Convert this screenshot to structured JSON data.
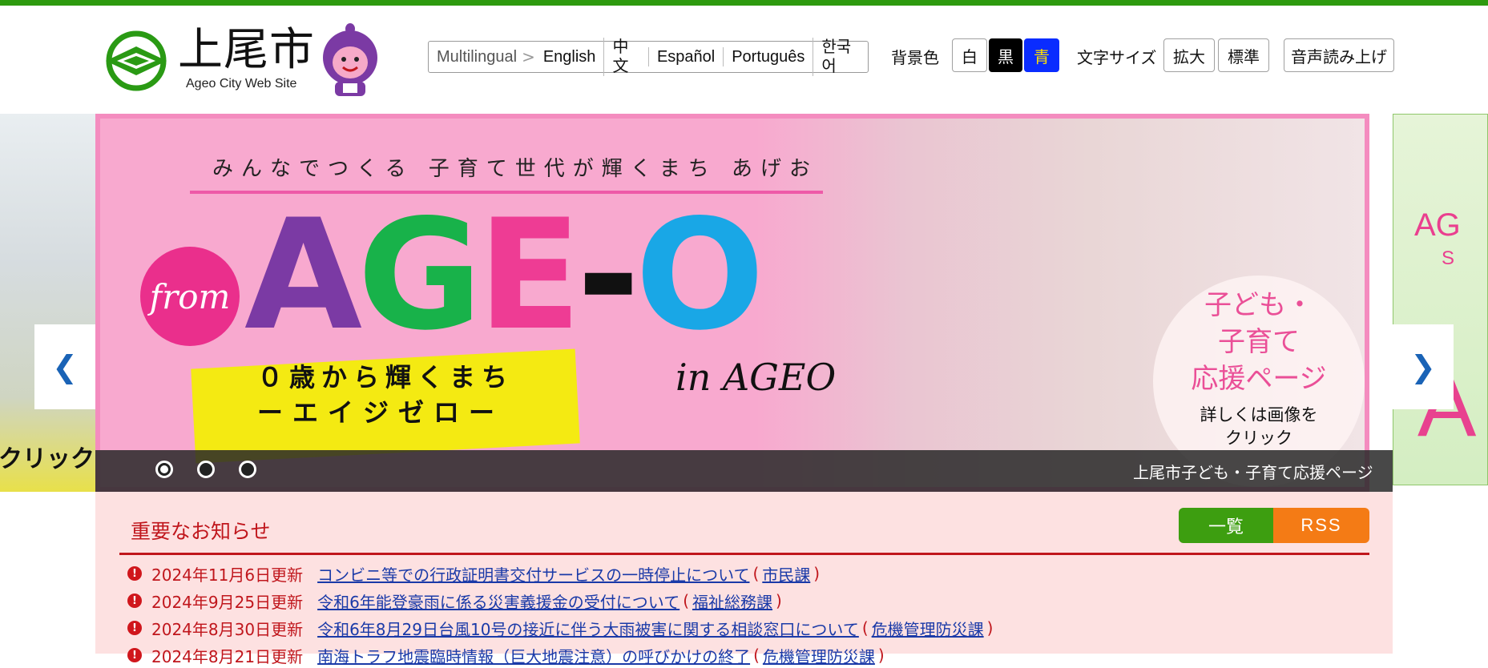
{
  "header": {
    "logo_title": "上尾市",
    "logo_sub": "Ageo City Web Site",
    "multilingual_label": "Multilingual",
    "languages": [
      "English",
      "中文",
      "Español",
      "Português",
      "한국어"
    ],
    "bg_color_label": "背景色",
    "bg_buttons": [
      "白",
      "黒",
      "青"
    ],
    "font_size_label": "文字サイズ",
    "font_buttons": [
      "拡大",
      "標準"
    ],
    "speech_button": "音声読み上げ"
  },
  "slider": {
    "left_side_text": "クリック",
    "right_side_text": "AG",
    "right_side_sub": "S",
    "right_side_big": "A",
    "tagline": "みんなでつくる 子育て世代が輝くまち あげお",
    "from_badge": "from",
    "ageo_letters": [
      "A",
      "G",
      "E",
      "-",
      "O"
    ],
    "yellow_line1": "０歳から輝くまち",
    "yellow_line2": "ーエイジゼロー",
    "in_ageo": "in AGEO",
    "circle_lines": [
      "子ども・",
      "子育て",
      "応援ページ"
    ],
    "circle_small": [
      "詳しくは画像を",
      "クリック"
    ],
    "caption": "上尾市子ども・子育て応援ページ",
    "prev_arrow": "❮",
    "next_arrow": "❯",
    "active_dot": 0,
    "dot_count": 3
  },
  "news": {
    "title": "重要なお知らせ",
    "list_button": "一覧",
    "rss_button": "RSS",
    "items": [
      {
        "date": "2024年11月6日更新",
        "title": "コンビニ等での行政証明書交付サービスの一時停止について",
        "dept": "市民課"
      },
      {
        "date": "2024年9月25日更新",
        "title": "令和6年能登豪雨に係る災害義援金の受付について",
        "dept": "福祉総務課"
      },
      {
        "date": "2024年8月30日更新",
        "title": "令和6年8月29日台風10号の接近に伴う大雨被害に関する相談窓口について",
        "dept": "危機管理防災課"
      },
      {
        "date": "2024年8月21日更新",
        "title": "南海トラフ地震臨時情報（巨大地震注意）の呼びかけの終了",
        "dept": "危機管理防災課"
      }
    ]
  },
  "colors": {
    "top_bar": "#2e9a0f",
    "banner_pink": "#f8a9cf",
    "news_bg": "#fde1e1",
    "news_red": "#c0161c",
    "link_blue": "#1a3aa8",
    "list_green": "#3d9e10",
    "rss_orange": "#f47b15"
  }
}
